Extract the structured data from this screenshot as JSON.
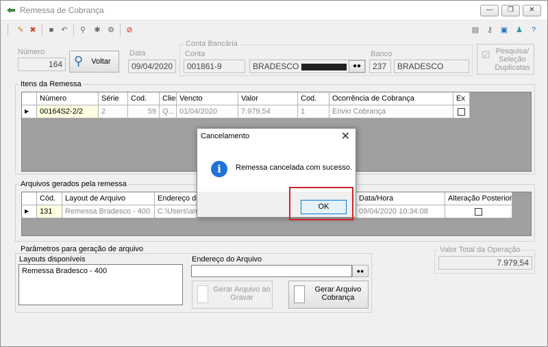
{
  "window": {
    "title": "Remessa de Cobrança",
    "controls": [
      "minimize",
      "restore",
      "close"
    ]
  },
  "toolbar": {
    "left_icons": [
      "edit-icon",
      "cancel-icon",
      "save-icon",
      "undo-icon",
      "search-icon",
      "tools-icon",
      "config-icon",
      "forbid-icon"
    ],
    "right_icons": [
      "window-icon",
      "key-icon",
      "display-icon",
      "user-icon",
      "help-icon"
    ]
  },
  "header": {
    "numero_label": "Número",
    "numero_value": "164",
    "voltar_label": "Voltar",
    "data_label": "Data",
    "data_value": "09/04/2020",
    "conta_group_label": "Conta Bancária",
    "conta_label": "Conta",
    "conta_value": "001861-9",
    "conta_name": "BRADESCO",
    "banco_label": "Banco",
    "banco_code": "237",
    "banco_name": "BRADESCO",
    "pesquisa_label": "Pesquisa/ Seleção Duplicatas"
  },
  "itens": {
    "title": "Itens da Remessa",
    "columns": [
      "Número",
      "Série",
      "Cod.",
      "Clier",
      "Vencto",
      "Valor",
      "Cod.",
      "Ocorrência de Cobrança",
      "Ex"
    ],
    "rows": [
      {
        "numero": "00164S2-2/2",
        "serie": "2",
        "cod": "59",
        "cliente": "Q...",
        "vencto": "01/04/2020",
        "valor": "7.979,54",
        "cod2": "1",
        "ocorrencia": "Envio Cobrança"
      }
    ]
  },
  "arquivos": {
    "title": "Arquivos gerados pela remessa",
    "columns": [
      "Cód.",
      "Layout de Arquivo",
      "Endereço do A",
      "Data/Hora",
      "Alteração Posterior"
    ],
    "rows": [
      {
        "cod": "131",
        "layout": "Remessa Bradesco - 400",
        "endereco": "C:\\Users\\amar",
        "datahora": "09/04/2020 10:34:08"
      }
    ]
  },
  "parametros": {
    "title": "Parâmetros para geração de arquivo",
    "layouts_label": "Layouts disponíveis",
    "layouts": [
      "Remessa Bradesco - 400"
    ],
    "endereco_label": "Endereço do Arquivo",
    "endereco_value": "",
    "gerar_gravar_label": "Gerar Arquivo ao Gravar",
    "gerar_cobranca_label": "Gerar Arquivo Cobrança"
  },
  "total": {
    "label": "Valor Total da Operação",
    "value": "7.979,54"
  },
  "dialog": {
    "title": "Cancelamento",
    "message": "Remessa cancelada com sucesso.",
    "ok_label": "OK",
    "icon": "info-icon"
  },
  "colors": {
    "highlight": "#d0202a",
    "selected_cell": "#ffffe1",
    "info_blue": "#1e73d8"
  }
}
